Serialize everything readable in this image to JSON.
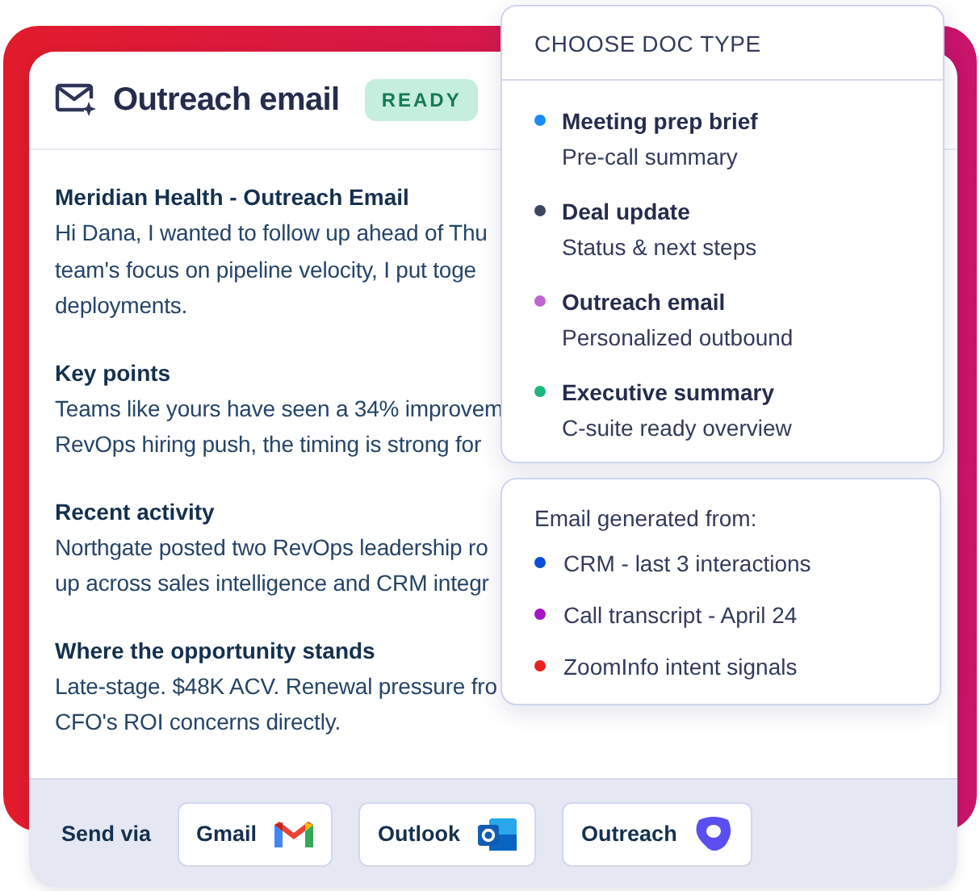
{
  "card": {
    "title": "Outreach email",
    "badge": "READY"
  },
  "sections": [
    {
      "heading": "Meridian Health - Outreach Email",
      "lines": [
        "Hi Dana, I wanted to follow up ahead of Thu",
        "team's focus on pipeline velocity, I put toge",
        "deployments."
      ]
    },
    {
      "heading": "Key points",
      "lines": [
        "Teams like yours have seen a 34% improvem",
        "RevOps hiring push, the timing is strong for"
      ]
    },
    {
      "heading": "Recent activity",
      "lines": [
        "Northgate posted two RevOps leadership ro",
        "up across sales intelligence and CRM integr"
      ]
    },
    {
      "heading": "Where the opportunity stands",
      "lines": [
        "Late-stage. $48K ACV. Renewal pressure fro",
        "CFO's ROI concerns directly."
      ]
    }
  ],
  "footer": {
    "label": "Send via",
    "buttons": [
      {
        "label": "Gmail",
        "kind": "gmail"
      },
      {
        "label": "Outlook",
        "kind": "outlook"
      },
      {
        "label": "Outreach",
        "kind": "outreach"
      }
    ]
  },
  "doc_type_menu": {
    "title": "CHOOSE DOC TYPE",
    "items": [
      {
        "label": "Meeting prep brief",
        "description": "Pre-call summary",
        "color": "#1a8cff"
      },
      {
        "label": "Deal update",
        "description": "Status & next steps",
        "color": "#3d4563"
      },
      {
        "label": "Outreach email",
        "description": "Personalized outbound",
        "color": "#c163d0"
      },
      {
        "label": "Executive summary",
        "description": "C-suite ready overview",
        "color": "#1bb87e"
      }
    ]
  },
  "sources": {
    "title": "Email generated from:",
    "items": [
      {
        "label": "CRM - last 3 interactions",
        "color": "#0b4fd9"
      },
      {
        "label": "Call transcript - April 24",
        "color": "#a515c4"
      },
      {
        "label": "ZoomInfo intent signals",
        "color": "#e8231f"
      }
    ]
  }
}
